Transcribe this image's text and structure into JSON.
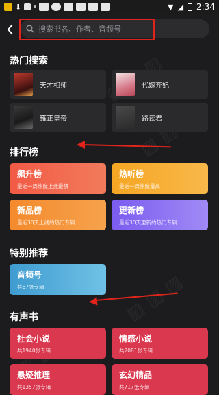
{
  "status_bar": {
    "time": "2:34"
  },
  "search": {
    "placeholder": "搜索书名、作者、音频号"
  },
  "sections": {
    "hot": "热门搜索",
    "rank": "排行榜",
    "special": "特别推荐",
    "audio": "有声书"
  },
  "hot_items": [
    {
      "label": "天才相师"
    },
    {
      "label": "代嫁弃妃"
    },
    {
      "label": "雍正皇帝"
    },
    {
      "label": "路读君"
    }
  ],
  "rank_items": [
    {
      "title": "飙升榜",
      "subtitle": "最近一周热度上涨最快",
      "color": "#f25a45"
    },
    {
      "title": "热听榜",
      "subtitle": "最近一周热度最高",
      "color": "#f6a623"
    },
    {
      "title": "新品榜",
      "subtitle": "最近30天上线的热门专辑",
      "color": "#f48a2c"
    },
    {
      "title": "更新榜",
      "subtitle": "最近30天更新的热门专辑",
      "color": "#8b6bf0"
    }
  ],
  "special_items": [
    {
      "title": "音频号",
      "subtitle": "共67张专辑",
      "color": "#4aa6d6"
    }
  ],
  "audio_items": [
    {
      "title": "社会小说",
      "subtitle": "共1940张专辑",
      "color": "#d9384f"
    },
    {
      "title": "情感小说",
      "subtitle": "共2081张专辑",
      "color": "#d9384f"
    },
    {
      "title": "悬疑推理",
      "subtitle": "共1357张专辑",
      "color": "#d9384f"
    },
    {
      "title": "玄幻精品",
      "subtitle": "共717张专辑",
      "color": "#d9384f"
    }
  ],
  "accent_color": "#e0241b"
}
